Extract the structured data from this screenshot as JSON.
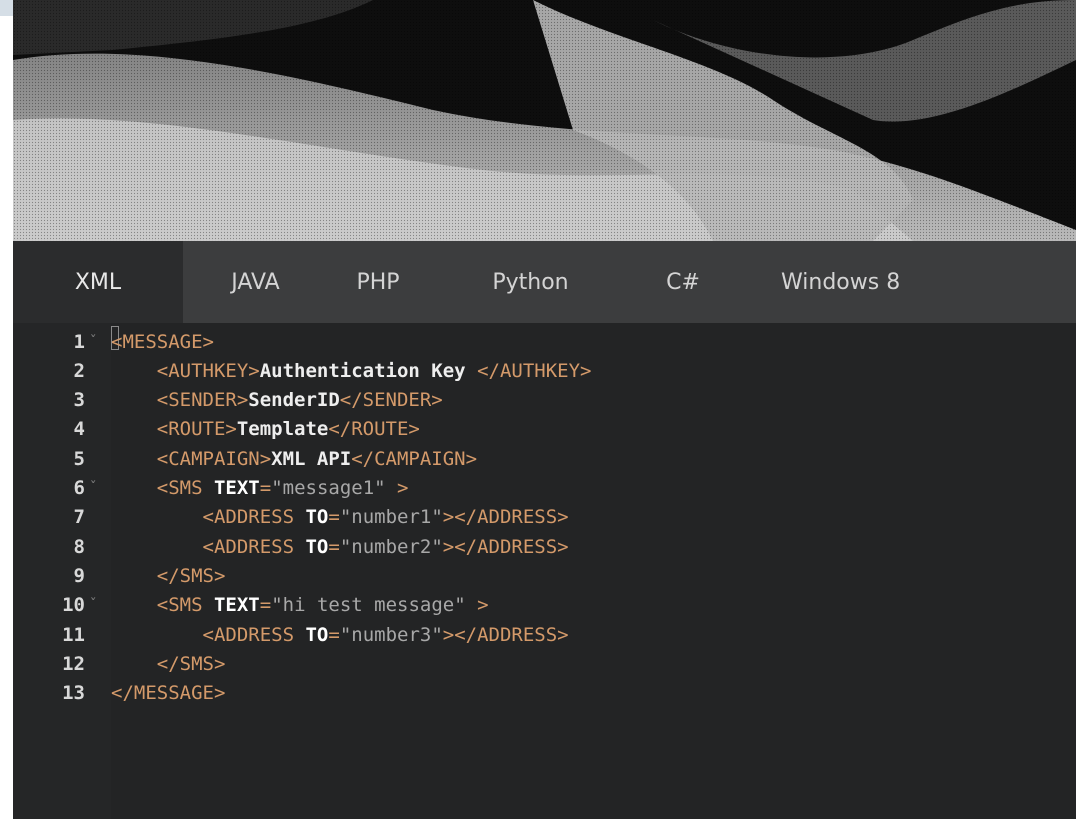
{
  "tabs": [
    {
      "label": "XML",
      "active": true
    },
    {
      "label": "JAVA",
      "active": false
    },
    {
      "label": "PHP",
      "active": false
    },
    {
      "label": "Python",
      "active": false
    },
    {
      "label": "C#",
      "active": false
    },
    {
      "label": "Windows 8",
      "active": false
    }
  ],
  "editor": {
    "lines": [
      {
        "num": "1",
        "fold": true,
        "indent": "",
        "parts": [
          [
            "tag",
            "<MESSAGE>"
          ]
        ]
      },
      {
        "num": "2",
        "fold": false,
        "indent": "    ",
        "parts": [
          [
            "tag",
            "<AUTHKEY>"
          ],
          [
            "txt",
            "Authentication Key "
          ],
          [
            "tag",
            "</AUTHKEY>"
          ]
        ]
      },
      {
        "num": "3",
        "fold": false,
        "indent": "    ",
        "parts": [
          [
            "tag",
            "<SENDER>"
          ],
          [
            "txt",
            "SenderID"
          ],
          [
            "tag",
            "</SENDER>"
          ]
        ]
      },
      {
        "num": "4",
        "fold": false,
        "indent": "    ",
        "parts": [
          [
            "tag",
            "<ROUTE>"
          ],
          [
            "txt",
            "Template"
          ],
          [
            "tag",
            "</ROUTE>"
          ]
        ]
      },
      {
        "num": "5",
        "fold": false,
        "indent": "    ",
        "parts": [
          [
            "tag",
            "<CAMPAIGN>"
          ],
          [
            "txt",
            "XML API"
          ],
          [
            "tag",
            "</CAMPAIGN>"
          ]
        ]
      },
      {
        "num": "6",
        "fold": true,
        "indent": "    ",
        "parts": [
          [
            "tag",
            "<SMS "
          ],
          [
            "attr",
            "TEXT"
          ],
          [
            "tag",
            "="
          ],
          [
            "str",
            "\"message1\""
          ],
          [
            "tag",
            " >"
          ]
        ]
      },
      {
        "num": "7",
        "fold": false,
        "indent": "        ",
        "parts": [
          [
            "tag",
            "<ADDRESS "
          ],
          [
            "attr",
            "TO"
          ],
          [
            "tag",
            "="
          ],
          [
            "str",
            "\"number1\""
          ],
          [
            "tag",
            "></ADDRESS>"
          ]
        ]
      },
      {
        "num": "8",
        "fold": false,
        "indent": "        ",
        "parts": [
          [
            "tag",
            "<ADDRESS "
          ],
          [
            "attr",
            "TO"
          ],
          [
            "tag",
            "="
          ],
          [
            "str",
            "\"number2\""
          ],
          [
            "tag",
            "></ADDRESS>"
          ]
        ]
      },
      {
        "num": "9",
        "fold": false,
        "indent": "    ",
        "parts": [
          [
            "tag",
            "</SMS>"
          ]
        ]
      },
      {
        "num": "10",
        "fold": true,
        "indent": "    ",
        "parts": [
          [
            "tag",
            "<SMS "
          ],
          [
            "attr",
            "TEXT"
          ],
          [
            "tag",
            "="
          ],
          [
            "str",
            "\"hi test message\""
          ],
          [
            "tag",
            " >"
          ]
        ]
      },
      {
        "num": "11",
        "fold": false,
        "indent": "        ",
        "parts": [
          [
            "tag",
            "<ADDRESS "
          ],
          [
            "attr",
            "TO"
          ],
          [
            "tag",
            "="
          ],
          [
            "str",
            "\"number3\""
          ],
          [
            "tag",
            "></ADDRESS>"
          ]
        ]
      },
      {
        "num": "12",
        "fold": false,
        "indent": "    ",
        "parts": [
          [
            "tag",
            "</SMS>"
          ]
        ]
      },
      {
        "num": "13",
        "fold": false,
        "indent": "",
        "parts": [
          [
            "tag",
            "</MESSAGE>"
          ]
        ]
      }
    ]
  },
  "colors": {
    "tag": "#d49a6a",
    "text": "#eeeeee",
    "string": "#a8a8a8",
    "tabbar": "#3c3d3e",
    "editor_bg": "#252627"
  },
  "icons": {
    "fold": "fold-arrow-icon"
  }
}
